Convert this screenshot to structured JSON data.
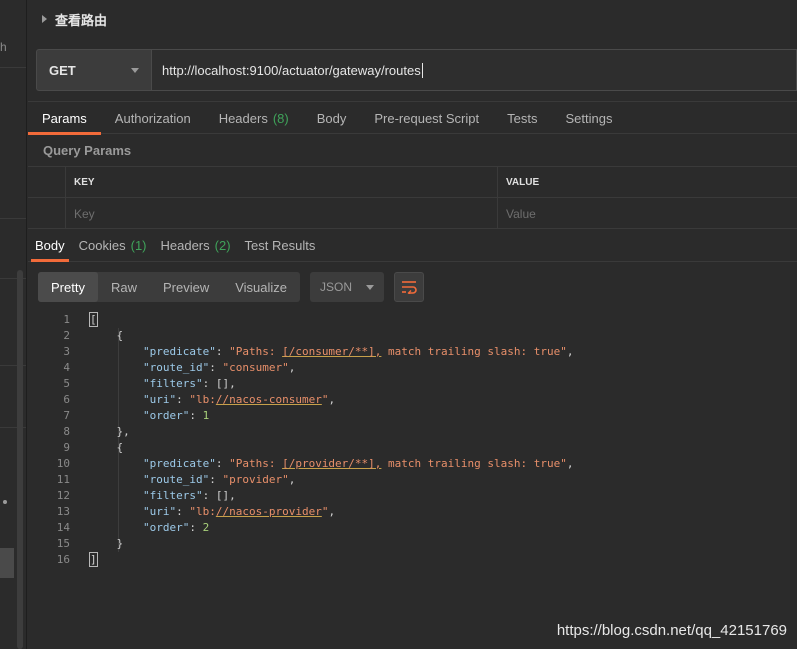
{
  "sidebar": {
    "fragment": "h"
  },
  "header": {
    "title": "查看路由"
  },
  "request": {
    "method": "GET",
    "url": "http://localhost:9100/actuator/gateway/routes"
  },
  "request_tabs": [
    {
      "label": "Params",
      "count": ""
    },
    {
      "label": "Authorization",
      "count": ""
    },
    {
      "label": "Headers",
      "count": "(8)"
    },
    {
      "label": "Body",
      "count": ""
    },
    {
      "label": "Pre-request Script",
      "count": ""
    },
    {
      "label": "Tests",
      "count": ""
    },
    {
      "label": "Settings",
      "count": ""
    }
  ],
  "query_params": {
    "label": "Query Params",
    "key_header": "KEY",
    "value_header": "VALUE",
    "key_placeholder": "Key",
    "value_placeholder": "Value"
  },
  "response_tabs": [
    {
      "label": "Body",
      "count": ""
    },
    {
      "label": "Cookies",
      "count": "(1)"
    },
    {
      "label": "Headers",
      "count": "(2)"
    },
    {
      "label": "Test Results",
      "count": ""
    }
  ],
  "toolbar": {
    "formats": [
      "Pretty",
      "Raw",
      "Preview",
      "Visualize"
    ],
    "language": "JSON"
  },
  "code_lines": [
    {
      "n": "1"
    },
    {
      "n": "2"
    },
    {
      "n": "3"
    },
    {
      "n": "4"
    },
    {
      "n": "5"
    },
    {
      "n": "6"
    },
    {
      "n": "7"
    },
    {
      "n": "8"
    },
    {
      "n": "9"
    },
    {
      "n": "10"
    },
    {
      "n": "11"
    },
    {
      "n": "12"
    },
    {
      "n": "13"
    },
    {
      "n": "14"
    },
    {
      "n": "15"
    },
    {
      "n": "16"
    }
  ],
  "routes": [
    {
      "predicate": "\"Paths: [/consumer/**], match trailing slash: true\"",
      "route_id": "\"consumer\"",
      "filters": "[]",
      "uri": "\"lb://nacos-consumer\"",
      "order": "1"
    },
    {
      "predicate": "\"Paths: [/provider/**], match trailing slash: true\"",
      "route_id": "\"provider\"",
      "filters": "[]",
      "uri": "\"lb://nacos-provider\"",
      "order": "2"
    }
  ],
  "keys": {
    "predicate": "\"predicate\"",
    "route_id": "\"route_id\"",
    "filters": "\"filters\"",
    "uri": "\"uri\"",
    "order": "\"order\""
  },
  "watermark": "https://blog.csdn.net/qq_42151769",
  "colors": {
    "accent": "#f26b3a",
    "count": "#3fa35a",
    "key": "#9cc9e8",
    "string": "#e88f6a",
    "number": "#a8d07a"
  }
}
